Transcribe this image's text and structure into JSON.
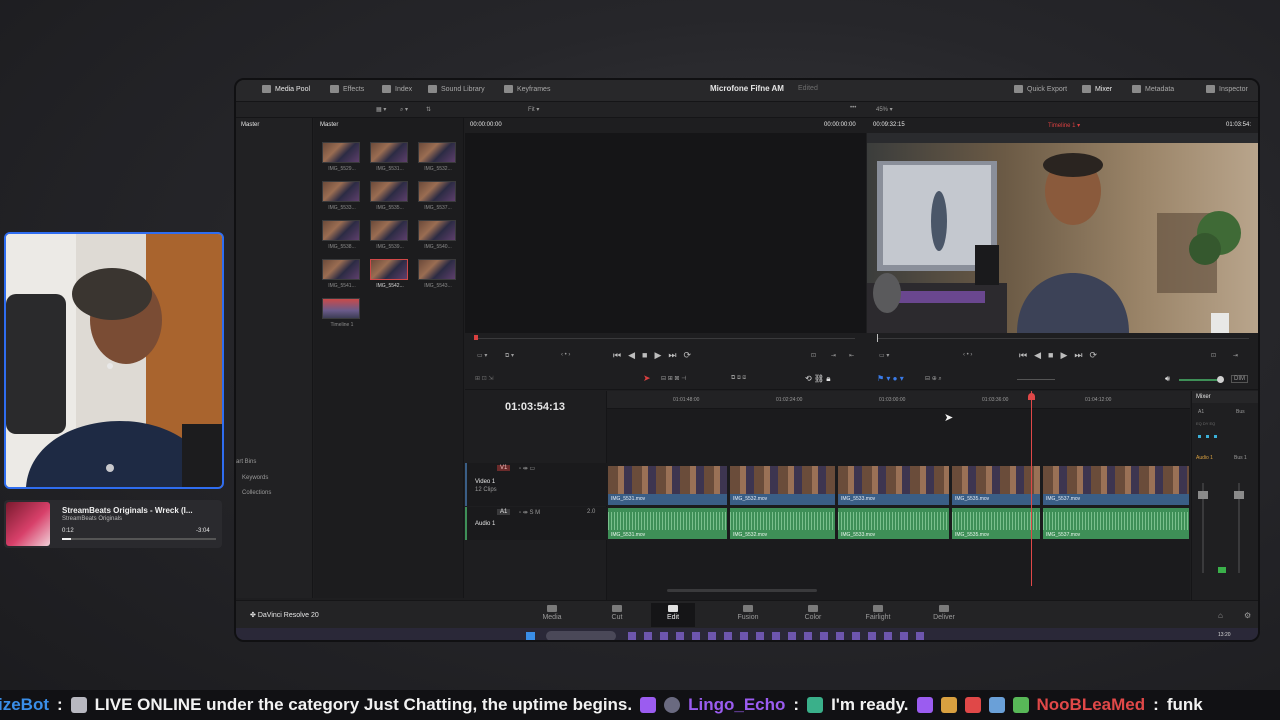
{
  "resolve": {
    "topbar": {
      "media_pool": "Media Pool",
      "effects": "Effects",
      "index": "Index",
      "sound_library": "Sound Library",
      "keyframes": "Keyframes",
      "project_title": "Microfone Fifne AM",
      "edited": "Edited",
      "quick_export": "Quick Export",
      "mixer": "Mixer",
      "metadata": "Metadata",
      "inspector": "Inspector"
    },
    "subbar": {
      "fit": "Fit",
      "zoom": "45%"
    },
    "bins": {
      "master_root": "Master",
      "master_header": "Master",
      "smart_bins": "art Bins",
      "keywords": "Keywords",
      "collections": "Collections"
    },
    "clips": [
      {
        "label": "IMG_5529..."
      },
      {
        "label": "IMG_5531..."
      },
      {
        "label": "IMG_5532..."
      },
      {
        "label": "IMG_5533..."
      },
      {
        "label": "IMG_5535..."
      },
      {
        "label": "IMG_5537..."
      },
      {
        "label": "IMG_5538..."
      },
      {
        "label": "IMG_5539..."
      },
      {
        "label": "IMG_5540..."
      },
      {
        "label": "IMG_5541..."
      },
      {
        "label": "IMG_5542..."
      },
      {
        "label": "IMG_5543..."
      },
      {
        "label": "Timeline 1"
      }
    ],
    "source_viewer": {
      "timecode_left": "00:00:00:00",
      "timecode_right": "00:00:00:00"
    },
    "program_viewer": {
      "timecode": "00:09:32:15",
      "timeline_name": "Timeline 1",
      "timecode_right": "01:03:54:"
    },
    "timeline": {
      "current_timecode": "01:03:54:13",
      "ruler": [
        "01:01:48:00",
        "01:02:24:00",
        "01:03:00:00",
        "01:03:36:00",
        "01:04:12:00"
      ],
      "video_track": {
        "badge": "V1",
        "name": "Video 1",
        "count": "12 Clips"
      },
      "audio_track": {
        "badge": "A1",
        "name": "Audio 1",
        "level": "2.0"
      },
      "clip_names": [
        "IMG_5531.mov",
        "IMG_5532.mov",
        "IMG_5533.mov",
        "IMG_5535.mov",
        "IMG_5537.mov"
      ],
      "dim": "DIM"
    },
    "mixer": {
      "title": "Mixer",
      "a1": "A1",
      "bus": "Bus",
      "audio1": "Audio 1",
      "bus1": "Bus 1"
    },
    "bottom": {
      "app_name": "DaVinci Resolve 20",
      "pages": [
        "Media",
        "Cut",
        "Edit",
        "Fusion",
        "Color",
        "Fairlight",
        "Deliver"
      ]
    },
    "clock": "13:20"
  },
  "now_playing": {
    "title": "StreamBeats Originals - Wreck (I...",
    "artist": "StreamBeats Originals",
    "elapsed": "0:12",
    "remaining": "-3:04"
  },
  "ticker": {
    "bot": "izeBot",
    "message": "LIVE ONLINE under the category Just Chatting, the uptime begins.",
    "user2": "Lingo_Echo",
    "message2": "I'm ready.",
    "user3": "NooBLeaMed",
    "message3": "funk"
  },
  "colors": {
    "accent_red": "#d94040",
    "video_clip": "#3a5e86",
    "audio_clip": "#3e8f57",
    "webcam_border": "#2f6df0",
    "ticker_user": "#9b5cf0"
  }
}
